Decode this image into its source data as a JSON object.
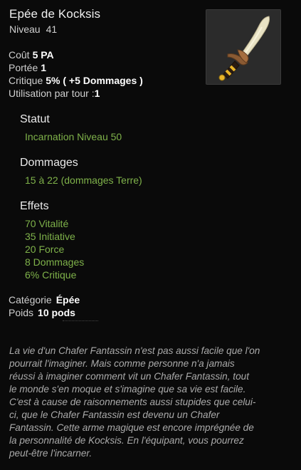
{
  "item": {
    "name": "Epée de Kocksis",
    "level_label": "Niveau",
    "level_value": "41"
  },
  "stats": {
    "cost_label": "Coût",
    "cost_value": "5 PA",
    "range_label": "Portée",
    "range_value": "1",
    "crit_label": "Critique",
    "crit_value": "5% ( +5 Dommages )",
    "uses_label": "Utilisation par tour :",
    "uses_value": "1"
  },
  "sections": {
    "status_title": "Statut",
    "status_items": [
      "Incarnation Niveau 50"
    ],
    "damage_title": "Dommages",
    "damage_items": [
      "15 à 22 (dommages Terre)"
    ],
    "effects_title": "Effets",
    "effects_items": [
      "70 Vitalité",
      "35 Initiative",
      "20 Force",
      "8 Dommages",
      "6% Critique"
    ]
  },
  "meta": {
    "category_label": "Catégorie",
    "category_value": "Épée",
    "weight_label": "Poids",
    "weight_value": "10 pods"
  },
  "description_lines": [
    "La vie d'un Chafer Fantassin n'est pas aussi facile que l'on",
    "pourrait l'imaginer. Mais comme personne n'a jamais",
    "réussi à imaginer comment vit un Chafer Fantassin, tout",
    "le monde s'en moque et s'imagine que sa vie est facile.",
    "C'est à cause de raisonnements aussi stupides que celui-",
    "ci, que le Chafer Fantassin est devenu un Chafer",
    "Fantassin. Cette arme magique est encore imprégnée de",
    "la personnalité de Kocksis. En l'équipant, vous pourrez",
    "peut-être l'incarner."
  ],
  "icons": {
    "item": "sword-icon"
  },
  "colors": {
    "effect_green": "#7fb24a",
    "value_white": "#ffffff",
    "description_gray": "#aaaaaa"
  }
}
